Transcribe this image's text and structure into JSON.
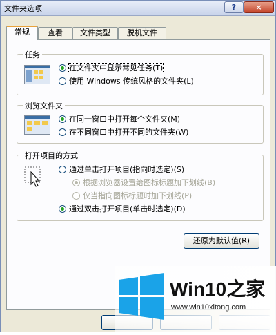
{
  "window": {
    "title": "文件夹选项",
    "help_label": "?",
    "close_label": "×"
  },
  "tabs": [
    {
      "label": "常规"
    },
    {
      "label": "查看"
    },
    {
      "label": "文件类型"
    },
    {
      "label": "脱机文件"
    }
  ],
  "tasks": {
    "label": "任务",
    "options": [
      {
        "label": "在文件夹中显示常见任务(T)",
        "selected": true
      },
      {
        "label": "使用 Windows 传统风格的文件夹(L)",
        "selected": false
      }
    ]
  },
  "browse": {
    "label": "浏览文件夹",
    "options": [
      {
        "label": "在同一窗口中打开每个文件夹(M)",
        "selected": true
      },
      {
        "label": "在不同窗口中打开不同的文件夹(W)",
        "selected": false
      }
    ]
  },
  "click": {
    "label": "打开项目的方式",
    "options": [
      {
        "label": "通过单击打开项目(指向时选定)(S)",
        "selected": false
      },
      {
        "label": "根据浏览器设置给图标标题加下划线(B)",
        "selected": true,
        "disabled": true
      },
      {
        "label": "仅当指向图标标题时加下划线(P)",
        "selected": false,
        "disabled": true
      },
      {
        "label": "通过双击打开项目(单击时选定)(D)",
        "selected": true
      }
    ]
  },
  "restore_button": "还原为默认值(R)",
  "watermark": {
    "brand": "Win10之家",
    "url": "www.win10xitong.com",
    "logo_color": "#1aa3e8"
  }
}
